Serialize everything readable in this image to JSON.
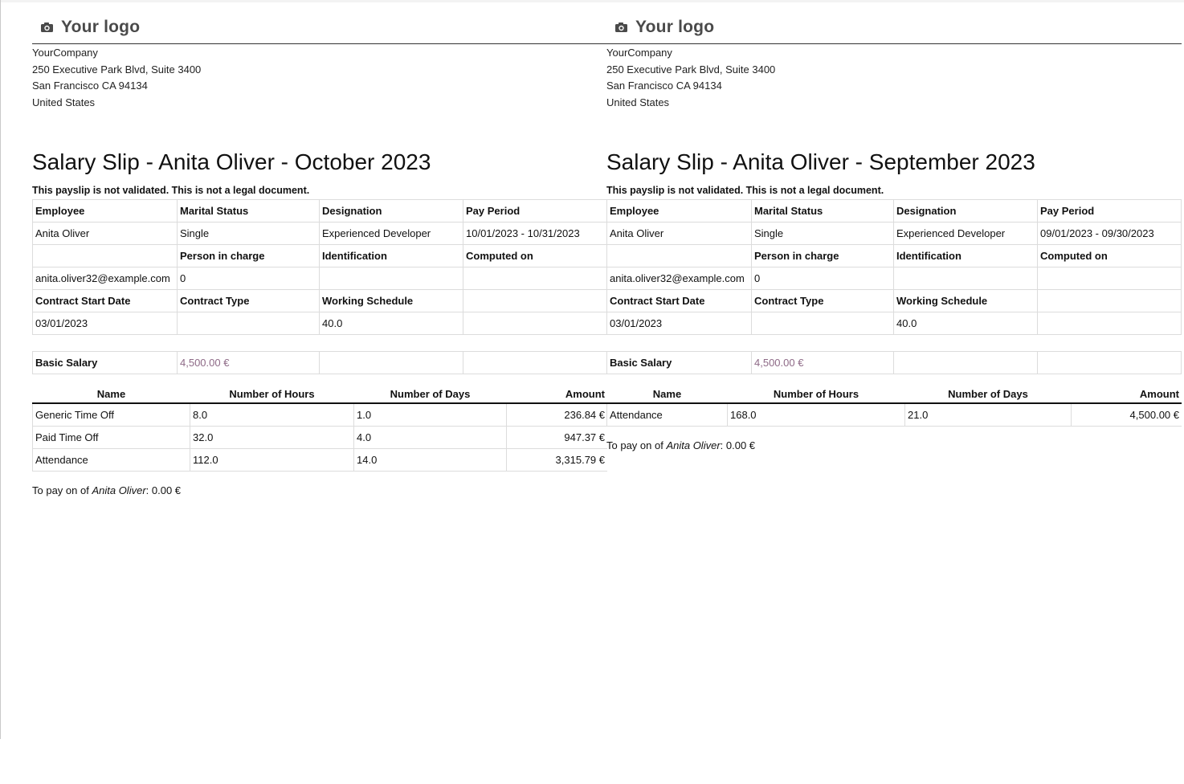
{
  "slips": [
    {
      "logo_text": "Your logo",
      "company": {
        "name": "YourCompany",
        "address_line1": "250 Executive Park Blvd, Suite 3400",
        "address_line2": "San Francisco CA 94134",
        "country": "United States"
      },
      "title": "Salary Slip - Anita Oliver - October 2023",
      "warning": "This payslip is not validated. This is not a legal document.",
      "info": {
        "employee_label": "Employee",
        "employee": "Anita Oliver",
        "marital_label": "Marital Status",
        "marital": "Single",
        "designation_label": "Designation",
        "designation": "Experienced Developer",
        "period_label": "Pay Period",
        "period": "10/01/2023 - 10/31/2023",
        "person_label": "Person in charge",
        "identification_label": "Identification",
        "computed_label": "Computed on",
        "email": "anita.oliver32@example.com",
        "person": "0",
        "contract_start_label": "Contract Start Date",
        "contract_type_label": "Contract Type",
        "schedule_label": "Working Schedule",
        "contract_start": "03/01/2023",
        "schedule": "40.0"
      },
      "basic_label": "Basic Salary",
      "basic_value": "4,500.00 €",
      "lines_headers": [
        "Name",
        "Number of Hours",
        "Number of Days",
        "Amount"
      ],
      "lines": [
        {
          "name": "Generic Time Off",
          "hours": "8.0",
          "days": "1.0",
          "amount": "236.84 €"
        },
        {
          "name": "Paid Time Off",
          "hours": "32.0",
          "days": "4.0",
          "amount": "947.37 €"
        },
        {
          "name": "Attendance",
          "hours": "112.0",
          "days": "14.0",
          "amount": "3,315.79 €"
        }
      ],
      "to_pay_prefix": "To pay on of",
      "to_pay_employee": "Anita Oliver",
      "to_pay_amount": ": 0.00 €"
    },
    {
      "logo_text": "Your logo",
      "company": {
        "name": "YourCompany",
        "address_line1": "250 Executive Park Blvd, Suite 3400",
        "address_line2": "San Francisco CA 94134",
        "country": "United States"
      },
      "title": "Salary Slip - Anita Oliver - September 2023",
      "warning": "This payslip is not validated. This is not a legal document.",
      "info": {
        "employee_label": "Employee",
        "employee": "Anita Oliver",
        "marital_label": "Marital Status",
        "marital": "Single",
        "designation_label": "Designation",
        "designation": "Experienced Developer",
        "period_label": "Pay Period",
        "period": "09/01/2023 - 09/30/2023",
        "person_label": "Person in charge",
        "identification_label": "Identification",
        "computed_label": "Computed on",
        "email": "anita.oliver32@example.com",
        "person": "0",
        "contract_start_label": "Contract Start Date",
        "contract_type_label": "Contract Type",
        "schedule_label": "Working Schedule",
        "contract_start": "03/01/2023",
        "schedule": "40.0"
      },
      "basic_label": "Basic Salary",
      "basic_value": "4,500.00 €",
      "lines_headers": [
        "Name",
        "Number of Hours",
        "Number of Days",
        "Amount"
      ],
      "lines": [
        {
          "name": "Attendance",
          "hours": "168.0",
          "days": "21.0",
          "amount": "4,500.00 €"
        }
      ],
      "to_pay_prefix": "To pay on of",
      "to_pay_employee": "Anita Oliver",
      "to_pay_amount": ": 0.00 €"
    }
  ],
  "icons": {
    "logo": "camera-icon"
  },
  "colors": {
    "money": "#8e6a87",
    "logo_text": "#4a4a4a"
  }
}
